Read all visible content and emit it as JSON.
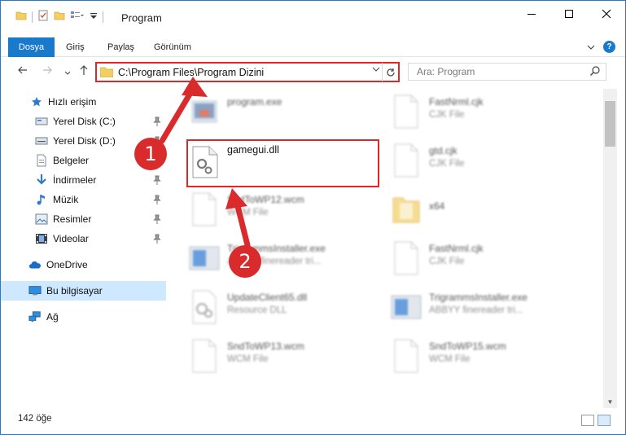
{
  "window": {
    "title": "Program",
    "controls": [
      "minimize-icon",
      "maximize-icon",
      "close-icon"
    ]
  },
  "ribbon": {
    "file_tab": "Dosya",
    "tabs": [
      "Giriş",
      "Paylaş",
      "Görünüm"
    ]
  },
  "nav": {
    "address": "C:\\Program Files\\Program Dizini",
    "search_placeholder": "Ara: Program"
  },
  "sidebar": {
    "items": [
      {
        "label": "Hızlı erişim",
        "icon": "star-icon"
      },
      {
        "label": "Yerel Disk (C:)",
        "icon": "drive-icon",
        "pinned": true
      },
      {
        "label": "Yerel Disk (D:)",
        "icon": "drive-icon",
        "pinned": true
      },
      {
        "label": "Belgeler",
        "icon": "documents-icon",
        "pinned": true
      },
      {
        "label": "İndirmeler",
        "icon": "download-icon",
        "pinned": true
      },
      {
        "label": "Müzik",
        "icon": "music-icon",
        "pinned": true
      },
      {
        "label": "Resimler",
        "icon": "pictures-icon",
        "pinned": true
      },
      {
        "label": "Videolar",
        "icon": "video-icon",
        "pinned": true
      },
      {
        "label": "OneDrive",
        "icon": "cloud-icon"
      },
      {
        "label": "Bu bilgisayar",
        "icon": "computer-icon",
        "selected": true
      },
      {
        "label": "Ağ",
        "icon": "network-icon"
      }
    ]
  },
  "files": [
    {
      "name": "program.exe",
      "type": ""
    },
    {
      "name": "FastNrml.cjk",
      "type": "CJK File"
    },
    {
      "name": "gamegui.dll",
      "type": ""
    },
    {
      "name": "gtd.cjk",
      "type": "CJK File"
    },
    {
      "name": "SndToWP12.wcm",
      "type": "WCM File"
    },
    {
      "name": "x64",
      "type": ""
    },
    {
      "name": "TrigrammsInstaller.exe",
      "type": "ABBYY finereader tri..."
    },
    {
      "name": "FastNrml.cjk",
      "type": "CJK File"
    },
    {
      "name": "UpdateClient65.dll",
      "type": "Resource DLL"
    },
    {
      "name": "TrigrammsInstaller.exe",
      "type": "ABBYY finereader tri..."
    },
    {
      "name": "SndToWP13.wcm",
      "type": "WCM File"
    },
    {
      "name": "SndToWP15.wcm",
      "type": "WCM File"
    }
  ],
  "status": {
    "count": "142 öğe"
  },
  "callouts": [
    "1",
    "2"
  ],
  "colors": {
    "accent": "#1979ca",
    "highlight": "#d92b2b",
    "selected_bg": "#cde8ff"
  }
}
